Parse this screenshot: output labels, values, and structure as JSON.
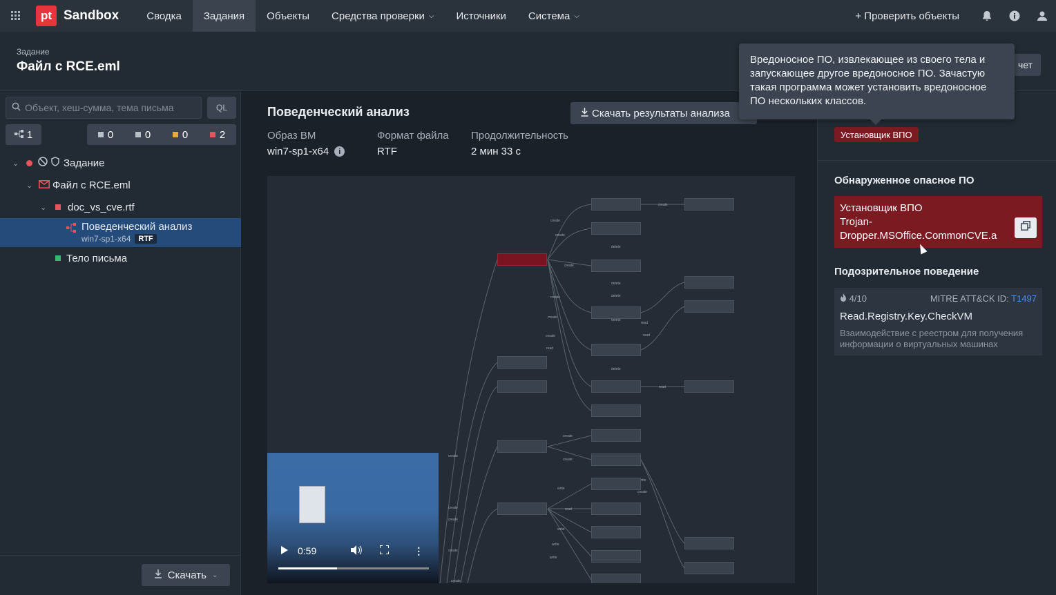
{
  "topbar": {
    "logo_text": "pt",
    "brand": "Sandbox",
    "nav": [
      "Сводка",
      "Задания",
      "Объекты",
      "Средства проверки",
      "Источники",
      "Система"
    ],
    "check_objects": "Проверить объекты",
    "icons": [
      "apps-grid-icon",
      "bell-icon",
      "info-icon",
      "user-icon"
    ]
  },
  "header": {
    "label": "Задание",
    "title": "Файл с RCE.eml",
    "report_btn": "чет"
  },
  "sidebar": {
    "search_placeholder": "Объект, хеш-сумма, тема письма",
    "ql": "QL",
    "tree_count": "1",
    "counts": [
      {
        "value": "0",
        "color": "#b7bfc8"
      },
      {
        "value": "0",
        "color": "#b7bfc8"
      },
      {
        "value": "0",
        "color": "#e8a93a"
      },
      {
        "value": "2",
        "color": "#e8545b"
      }
    ],
    "tree": {
      "task": "Задание",
      "email": "Файл с RCE.eml",
      "doc": "doc_vs_cve.rtf",
      "analysis": "Поведенческий анализ",
      "analysis_sub": "win7-sp1-x64",
      "analysis_badge": "RTF",
      "body": "Тело письма"
    },
    "download": "Скачать"
  },
  "center": {
    "title": "Поведенческий анализ",
    "download_results": "Скачать результаты анализа",
    "meta": {
      "vm_label": "Образ ВМ",
      "vm_value": "win7-sp1-x64",
      "format_label": "Формат файла",
      "format_value": "RTF",
      "duration_label": "Продолжительность",
      "duration_value": "2 мин 33 с"
    },
    "video_time": "0:59",
    "video_progress": 0.39
  },
  "right": {
    "badge": "Установщик ВПО",
    "detected_title": "Обнаруженное опасное ПО",
    "malware_type": "Установщик ВПО",
    "malware_name": "Trojan-Dropper.MSOffice.CommonCVE.a",
    "suspicious_title": "Подозрительное поведение",
    "score": "4/10",
    "mitre_label": "MITRE ATT&CK ID:",
    "mitre_id": "T1497",
    "rule": "Read.Registry.Key.CheckVM",
    "rule_desc": "Взаимодействие с реестром для получения информации о виртуальных машинах"
  },
  "tooltip": {
    "text": "Вредоносное ПО, извлекающее из своего тела и запускающее другое вредоносное ПО. Зачастую такая программа может установить вредоносное ПО нескольких классов."
  }
}
